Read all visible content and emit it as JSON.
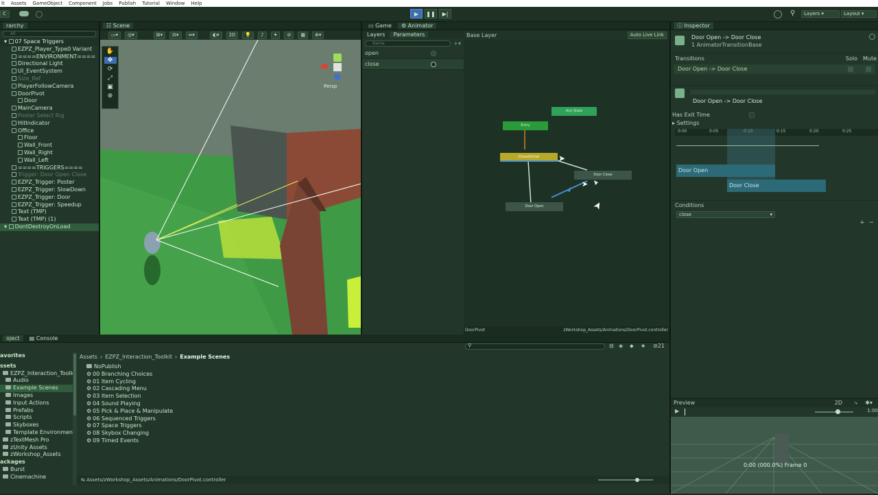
{
  "menu": [
    "lt",
    "Assets",
    "GameObject",
    "Component",
    "Jobs",
    "Publish",
    "Tutorial",
    "Window",
    "Help"
  ],
  "toolbar": {
    "account": "C",
    "layers": "Layers",
    "layout": "Layout"
  },
  "hierarchy": {
    "tab": "rarchy",
    "search_placeholder": "All",
    "scene": "07 Space Triggers",
    "items": [
      {
        "label": "EZPZ_Player_Type0 Variant",
        "indent": 1,
        "dim": false
      },
      {
        "label": "====ENVIRONMENT====",
        "indent": 1,
        "dim": false
      },
      {
        "label": "Directional Light",
        "indent": 1,
        "dim": false
      },
      {
        "label": "UI_EventSystem",
        "indent": 1,
        "dim": false
      },
      {
        "label": "Size_Ref",
        "indent": 1,
        "dim": true
      },
      {
        "label": "PlayerFollowCamera",
        "indent": 1,
        "dim": false
      },
      {
        "label": "DoorPivot",
        "indent": 1,
        "dim": false
      },
      {
        "label": "Door",
        "indent": 2,
        "dim": false
      },
      {
        "label": "MainCamera",
        "indent": 1,
        "dim": false
      },
      {
        "label": "Poster Select Rig",
        "indent": 1,
        "dim": true
      },
      {
        "label": "HitIndicator",
        "indent": 1,
        "dim": false
      },
      {
        "label": "Office",
        "indent": 1,
        "dim": false
      },
      {
        "label": "Floor",
        "indent": 2,
        "dim": false
      },
      {
        "label": "Wall_Front",
        "indent": 2,
        "dim": false
      },
      {
        "label": "Wall_Right",
        "indent": 2,
        "dim": false
      },
      {
        "label": "Wall_Left",
        "indent": 2,
        "dim": false
      },
      {
        "label": "====TRIGGERS====",
        "indent": 1,
        "dim": false
      },
      {
        "label": "Trigger: Door Open Close",
        "indent": 1,
        "dim": true
      },
      {
        "label": "EZPZ_Trigger: Poster",
        "indent": 1,
        "dim": false
      },
      {
        "label": "EZPZ_Trigger: SlowDown",
        "indent": 1,
        "dim": false
      },
      {
        "label": "EZPZ_Trigger: Door",
        "indent": 1,
        "dim": false
      },
      {
        "label": "EZPZ_Trigger: Speedup",
        "indent": 1,
        "dim": false
      },
      {
        "label": "Text (TMP)",
        "indent": 1,
        "dim": false
      },
      {
        "label": "Text (TMP) (1)",
        "indent": 1,
        "dim": false
      }
    ],
    "dont_destroy": "DontDestroyOnLoad"
  },
  "scene_view": {
    "tab": "Scene",
    "mode_2d": "2D",
    "persp": "Persp"
  },
  "animator": {
    "tab_game": "Game",
    "tab_animator": "Animator",
    "tab_layers": "Layers",
    "tab_parameters": "Parameters",
    "search_placeholder": "Name",
    "params": [
      "open",
      "close"
    ],
    "base_layer": "Base Layer",
    "auto_live_link": "Auto Live Link",
    "nodes": {
      "any_state": "Any State",
      "entry": "Entry",
      "closed_initial": "ClosedInitial",
      "door_close": "Door Close",
      "door_open": "Door Open"
    },
    "footer_left": "DoorPivot",
    "footer_right": "zWorkshop_Assets/Animations/DoorPivot.controller"
  },
  "inspector": {
    "tab": "Inspector",
    "title": "Door Open -> Door Close",
    "subtitle": "1 AnimatorTransitionBase",
    "transitions_label": "Transitions",
    "solo": "Solo",
    "mute": "Mute",
    "transition_item": "Door Open -> Door Close",
    "section_title": "Door Open -> Door Close",
    "has_exit_time": "Has Exit Time",
    "settings": "Settings",
    "timeline_ticks": [
      "0:00",
      "0:05",
      "0:10",
      "0:15",
      "0:20",
      "0:25"
    ],
    "clip_open": "Door Open",
    "clip_close": "Door Close",
    "conditions_label": "Conditions",
    "condition_value": "close",
    "preview": "Preview",
    "preview_2d": "2D",
    "preview_end": "1:00",
    "preview_status": "0:00 (000.0%) Frame 0"
  },
  "project": {
    "tab_project": "oject",
    "tab_console": "Console",
    "favorites": "avorites",
    "tree": [
      {
        "label": "ssets",
        "indent": 0,
        "sel": false
      },
      {
        "label": "EZPZ_Interaction_Toolkit",
        "indent": 1,
        "sel": false
      },
      {
        "label": "Audio",
        "indent": 2,
        "sel": false
      },
      {
        "label": "Example Scenes",
        "indent": 2,
        "sel": true
      },
      {
        "label": "Images",
        "indent": 2,
        "sel": false
      },
      {
        "label": "Input Actions",
        "indent": 2,
        "sel": false
      },
      {
        "label": "Prefabs",
        "indent": 2,
        "sel": false
      },
      {
        "label": "Scripts",
        "indent": 2,
        "sel": false
      },
      {
        "label": "Skyboxes",
        "indent": 2,
        "sel": false
      },
      {
        "label": "Template Environment",
        "indent": 2,
        "sel": false
      },
      {
        "label": "zTextMesh Pro",
        "indent": 1,
        "sel": false
      },
      {
        "label": "zUnity Assets",
        "indent": 1,
        "sel": false
      },
      {
        "label": "zWorkshop_Assets",
        "indent": 1,
        "sel": false
      },
      {
        "label": "ackages",
        "indent": 0,
        "sel": false
      },
      {
        "label": "Burst",
        "indent": 1,
        "sel": false
      },
      {
        "label": "Cinemachine",
        "indent": 1,
        "sel": false
      }
    ],
    "breadcrumb": [
      "Assets",
      "EZPZ_Interaction_Toolkit",
      "Example Scenes"
    ],
    "files": [
      {
        "label": "NoPublish",
        "type": "folder"
      },
      {
        "label": "00 Branching Choices",
        "type": "scene"
      },
      {
        "label": "01 Item Cycling",
        "type": "scene"
      },
      {
        "label": "02 Cascading Menu",
        "type": "scene"
      },
      {
        "label": "03 Item Selection",
        "type": "scene"
      },
      {
        "label": "04 Sound Playing",
        "type": "scene"
      },
      {
        "label": "05 Pick & Place & Manipulate",
        "type": "scene"
      },
      {
        "label": "06 Sequenced Triggers",
        "type": "scene"
      },
      {
        "label": "07 Space Triggers",
        "type": "scene"
      },
      {
        "label": "08 Skybox Changing",
        "type": "scene"
      },
      {
        "label": "09 Timed Events",
        "type": "scene"
      }
    ],
    "hidden_count": "21",
    "status_path": "Assets/zWorkshop_Assets/Animations/DoorPivot.controller"
  }
}
